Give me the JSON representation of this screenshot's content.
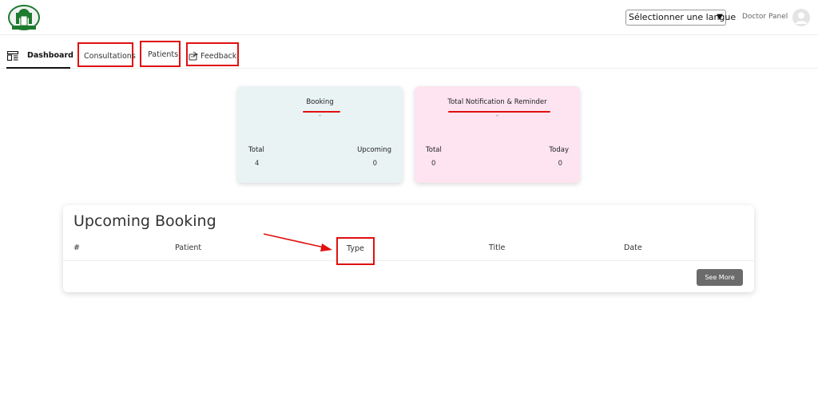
{
  "header": {
    "language_select": "Sélectionner une langue",
    "language_arrow": "▼",
    "doctor_panel": "Doctor Panel"
  },
  "tabs": [
    {
      "label": "Dashboard"
    },
    {
      "label": "Consultations"
    },
    {
      "label": "Patients"
    },
    {
      "label": "Feedback"
    }
  ],
  "cards": {
    "booking": {
      "title": "Booking",
      "subtitle": "-",
      "left_label": "Total",
      "left_value": "4",
      "right_label": "Upcoming",
      "right_value": "0"
    },
    "notification": {
      "title": "Total Notification & Reminder",
      "subtitle": "-",
      "left_label": "Total",
      "left_value": "0",
      "right_label": "Today",
      "right_value": "0"
    }
  },
  "upcoming": {
    "title": "Upcoming Booking",
    "columns": [
      "#",
      "Patient",
      "Type",
      "Title",
      "Date"
    ],
    "see_more": "See More"
  },
  "colors": {
    "annotation_red": "#e01010",
    "booking_card": "#e9f3f4",
    "notification_card": "#fde4f0",
    "button": "#6b6b6b"
  }
}
